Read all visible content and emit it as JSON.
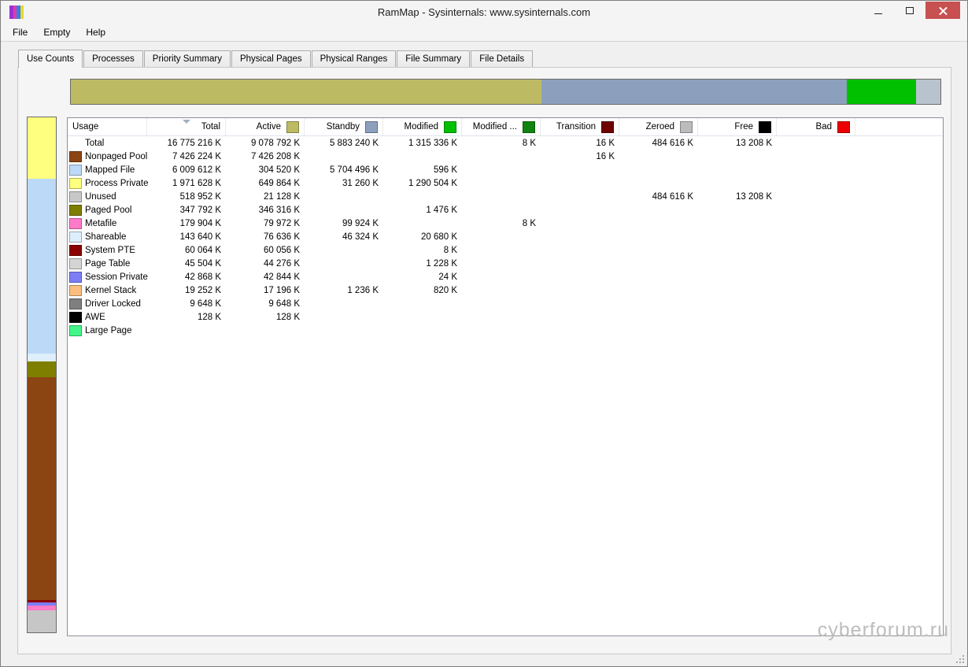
{
  "window": {
    "title": "RamMap - Sysinternals: www.sysinternals.com",
    "icon_colors": [
      "#9B30D6",
      "#E03BA8",
      "#2F7FE8",
      "#E8D832"
    ]
  },
  "menu": {
    "items": [
      "File",
      "Empty",
      "Help"
    ]
  },
  "tabs": {
    "active": "Use Counts",
    "items": [
      "Use Counts",
      "Processes",
      "Priority Summary",
      "Physical Pages",
      "Physical Ranges",
      "File Summary",
      "File Details"
    ]
  },
  "table": {
    "columns": [
      {
        "label": "Usage"
      },
      {
        "label": "Total",
        "sort_indicator": true
      },
      {
        "label": "Active",
        "swatch": "#BDBA64"
      },
      {
        "label": "Standby",
        "swatch": "#8CA0BE"
      },
      {
        "label": "Modified",
        "swatch": "#00C000"
      },
      {
        "label": "Modified ...",
        "swatch": "#108410"
      },
      {
        "label": "Transition",
        "swatch": "#6E0000"
      },
      {
        "label": "Zeroed",
        "swatch": "#BCBCBC"
      },
      {
        "label": "Free",
        "swatch": "#000000"
      },
      {
        "label": "Bad",
        "swatch": "#EC0000"
      }
    ],
    "rows": [
      {
        "label": "Total",
        "swatch": null,
        "values": [
          "16 775 216 K",
          "9 078 792 K",
          "5 883 240 K",
          "1 315 336 K",
          "8 K",
          "16 K",
          "484 616 K",
          "13 208 K",
          ""
        ]
      },
      {
        "label": "Nonpaged Pool",
        "swatch": "#8B4513",
        "values": [
          "7 426 224 K",
          "7 426 208 K",
          "",
          "",
          "",
          "16 K",
          "",
          "",
          ""
        ]
      },
      {
        "label": "Mapped File",
        "swatch": "#BCD9F7",
        "values": [
          "6 009 612 K",
          "304 520 K",
          "5 704 496 K",
          "596 K",
          "",
          "",
          "",
          "",
          ""
        ]
      },
      {
        "label": "Process Private",
        "swatch": "#FFFF7F",
        "values": [
          "1 971 628 K",
          "649 864 K",
          "31 260 K",
          "1 290 504 K",
          "",
          "",
          "",
          "",
          ""
        ]
      },
      {
        "label": "Unused",
        "swatch": "#C8C8C8",
        "values": [
          "518 952 K",
          "21 128 K",
          "",
          "",
          "",
          "",
          "484 616 K",
          "13 208 K",
          ""
        ]
      },
      {
        "label": "Paged Pool",
        "swatch": "#7E7E00",
        "values": [
          "347 792 K",
          "346 316 K",
          "",
          "1 476 K",
          "",
          "",
          "",
          "",
          ""
        ]
      },
      {
        "label": "Metafile",
        "swatch": "#FF7AC8",
        "values": [
          "179 904 K",
          "79 972 K",
          "99 924 K",
          "",
          "8 K",
          "",
          "",
          "",
          ""
        ]
      },
      {
        "label": "Shareable",
        "swatch": "#DFEEFB",
        "values": [
          "143 640 K",
          "76 636 K",
          "46 324 K",
          "20 680 K",
          "",
          "",
          "",
          "",
          ""
        ]
      },
      {
        "label": "System PTE",
        "swatch": "#8B0000",
        "values": [
          "60 064 K",
          "60 056 K",
          "",
          "8 K",
          "",
          "",
          "",
          "",
          ""
        ]
      },
      {
        "label": "Page Table",
        "swatch": "#D4D4D4",
        "values": [
          "45 504 K",
          "44 276 K",
          "",
          "1 228 K",
          "",
          "",
          "",
          "",
          ""
        ]
      },
      {
        "label": "Session Private",
        "swatch": "#7D7DF6",
        "values": [
          "42 868 K",
          "42 844 K",
          "",
          "24 K",
          "",
          "",
          "",
          "",
          ""
        ]
      },
      {
        "label": "Kernel Stack",
        "swatch": "#FBBE7E",
        "values": [
          "19 252 K",
          "17 196 K",
          "1 236 K",
          "820 K",
          "",
          "",
          "",
          "",
          ""
        ]
      },
      {
        "label": "Driver Locked",
        "swatch": "#7F7F7F",
        "values": [
          "9 648 K",
          "9 648 K",
          "",
          "",
          "",
          "",
          "",
          "",
          ""
        ]
      },
      {
        "label": "AWE",
        "swatch": "#000000",
        "values": [
          "128 K",
          "128 K",
          "",
          "",
          "",
          "",
          "",
          "",
          ""
        ]
      },
      {
        "label": "Large Page",
        "swatch": "#42F788",
        "values": [
          "",
          "",
          "",
          "",
          "",
          "",
          "",
          "",
          ""
        ]
      }
    ]
  },
  "bars": {
    "horizontal": {
      "segments": [
        {
          "name": "active",
          "color": "#BDBA64",
          "percent": 54.1
        },
        {
          "name": "standby",
          "color": "#8CA0BE",
          "percent": 35.1
        },
        {
          "name": "modified",
          "color": "#00C000",
          "percent": 8.0
        },
        {
          "name": "zeroed",
          "color": "#B9C3CD",
          "percent": 2.8
        }
      ]
    },
    "vertical": {
      "segments": [
        {
          "name": "process-private",
          "color": "#FFFF7F",
          "percent": 11.9
        },
        {
          "name": "mapped-file",
          "color": "#BCD9F7",
          "percent": 33.9
        },
        {
          "name": "shareable",
          "color": "#DFEEFB",
          "percent": 1.6
        },
        {
          "name": "paged-pool",
          "color": "#7E7E00",
          "percent": 3.1
        },
        {
          "name": "nonpaged-pool",
          "color": "#8B4513",
          "percent": 43.2
        },
        {
          "name": "system-pte",
          "color": "#8B0000",
          "percent": 0.5
        },
        {
          "name": "session-private",
          "color": "#7D7DF6",
          "percent": 0.6
        },
        {
          "name": "metafile",
          "color": "#FF7AC8",
          "percent": 1.0
        },
        {
          "name": "unused",
          "color": "#C6C6C6",
          "percent": 4.2
        }
      ]
    }
  },
  "watermark": "cyberforum.ru"
}
